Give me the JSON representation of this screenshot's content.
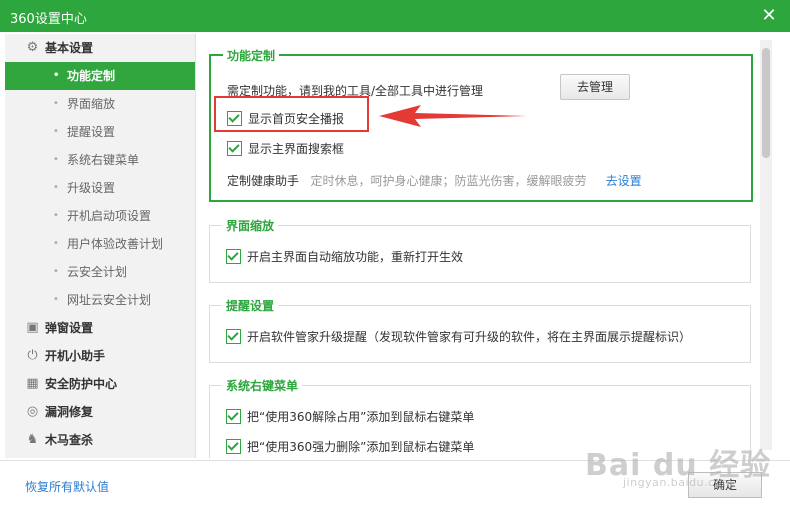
{
  "window": {
    "title": "360设置中心",
    "close_symbol": "✕"
  },
  "sidebar": {
    "items": [
      {
        "label": "基本设置",
        "type": "section",
        "icon": "gear-icon",
        "glyph": "⚙"
      },
      {
        "label": "功能定制",
        "type": "sub",
        "active": true
      },
      {
        "label": "界面缩放",
        "type": "sub"
      },
      {
        "label": "提醒设置",
        "type": "sub"
      },
      {
        "label": "系统右键菜单",
        "type": "sub"
      },
      {
        "label": "升级设置",
        "type": "sub"
      },
      {
        "label": "开机启动项设置",
        "type": "sub"
      },
      {
        "label": "用户体验改善计划",
        "type": "sub"
      },
      {
        "label": "云安全计划",
        "type": "sub"
      },
      {
        "label": "网址云安全计划",
        "type": "sub"
      },
      {
        "label": "弹窗设置",
        "type": "section",
        "icon": "popup-window-icon",
        "glyph": "▣"
      },
      {
        "label": "开机小助手",
        "type": "section",
        "icon": "power-icon",
        "glyph": "⏻"
      },
      {
        "label": "安全防护中心",
        "type": "section",
        "icon": "grid-icon",
        "glyph": "▦"
      },
      {
        "label": "漏洞修复",
        "type": "section",
        "icon": "patch-icon",
        "glyph": "◎"
      },
      {
        "label": "木马查杀",
        "type": "section",
        "icon": "horse-icon",
        "glyph": "♞"
      }
    ]
  },
  "sections": {
    "function_custom": {
      "title": "功能定制",
      "manage_desc": "需定制功能，请到我的工具/全部工具中进行管理",
      "manage_button": "去管理",
      "show_home_safety": "显示首页安全播报",
      "show_main_search": "显示主界面搜索框",
      "health_label": "定制健康助手",
      "health_desc": "定时休息，呵护身心健康；防蓝光伤害，缓解眼疲劳",
      "health_link": "去设置"
    },
    "zoom": {
      "title": "界面缩放",
      "auto_zoom": "开启主界面自动缩放功能，重新打开生效"
    },
    "reminder": {
      "title": "提醒设置",
      "upgrade_remind": "开启软件管家升级提醒（发现软件管家有可升级的软件，将在主界面展示提醒标识）"
    },
    "context_menu": {
      "title": "系统右键菜单",
      "unlock_item": "把“使用360解除占用”添加到鼠标右键菜单",
      "force_delete_item": "把“使用360强力删除”添加到鼠标右键菜单"
    }
  },
  "footer": {
    "restore_defaults": "恢复所有默认值",
    "ok_button": "确定"
  },
  "watermark": {
    "logo": "Bai du 经验",
    "url": "jingyan.baidu.com"
  },
  "colors": {
    "accent": "#2ca63d",
    "link": "#2a7dd1",
    "annotation": "#e53935"
  }
}
